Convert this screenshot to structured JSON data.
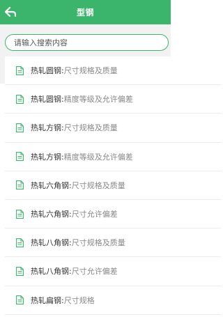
{
  "header": {
    "title": "型钢",
    "back_icon": "back-arrow-icon",
    "color": "#3cb56c"
  },
  "search": {
    "placeholder": "请输入搜索内容"
  },
  "items": [
    {
      "name": "热轧圆钢",
      "sep": ":",
      "desc": "尺寸规格及质量"
    },
    {
      "name": "热轧圆钢",
      "sep": ":",
      "desc": "精度等级及允许偏差"
    },
    {
      "name": "热轧方钢",
      "sep": ":",
      "desc": "尺寸规格及质量"
    },
    {
      "name": "热轧方钢",
      "sep": ":",
      "desc": "精度等级及允许偏差"
    },
    {
      "name": "热轧六角钢",
      "sep": ":",
      "desc": "尺寸规格及质量"
    },
    {
      "name": "热轧六角钢",
      "sep": ":",
      "desc": "尺寸允许偏差"
    },
    {
      "name": "热轧八角钢",
      "sep": ":",
      "desc": "尺寸规格及质量"
    },
    {
      "name": "热轧八角钢",
      "sep": ":",
      "desc": "尺寸允许偏差"
    },
    {
      "name": "热轧扁钢",
      "sep": ":",
      "desc": "尺寸规格"
    }
  ]
}
